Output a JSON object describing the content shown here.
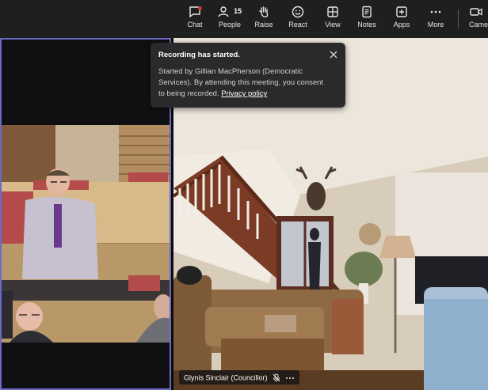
{
  "toolbar": {
    "chat": "Chat",
    "people": "People",
    "people_count": "15",
    "raise": "Raise",
    "react": "React",
    "view": "View",
    "notes": "Notes",
    "apps": "Apps",
    "more": "More",
    "camera": "Camera"
  },
  "toast": {
    "title": "Recording has started.",
    "body": "Started by Gillian MacPherson (Democratic Services). By attending this meeting, you consent to being recorded.",
    "link": "Privacy policy"
  },
  "participant": {
    "name": "Glynis Sinclair (Councillor)"
  },
  "colors": {
    "toolbar_bg": "#1f1f1f",
    "active_speaker_border": "#6b6ac6",
    "toast_bg": "#2a2a2c"
  }
}
